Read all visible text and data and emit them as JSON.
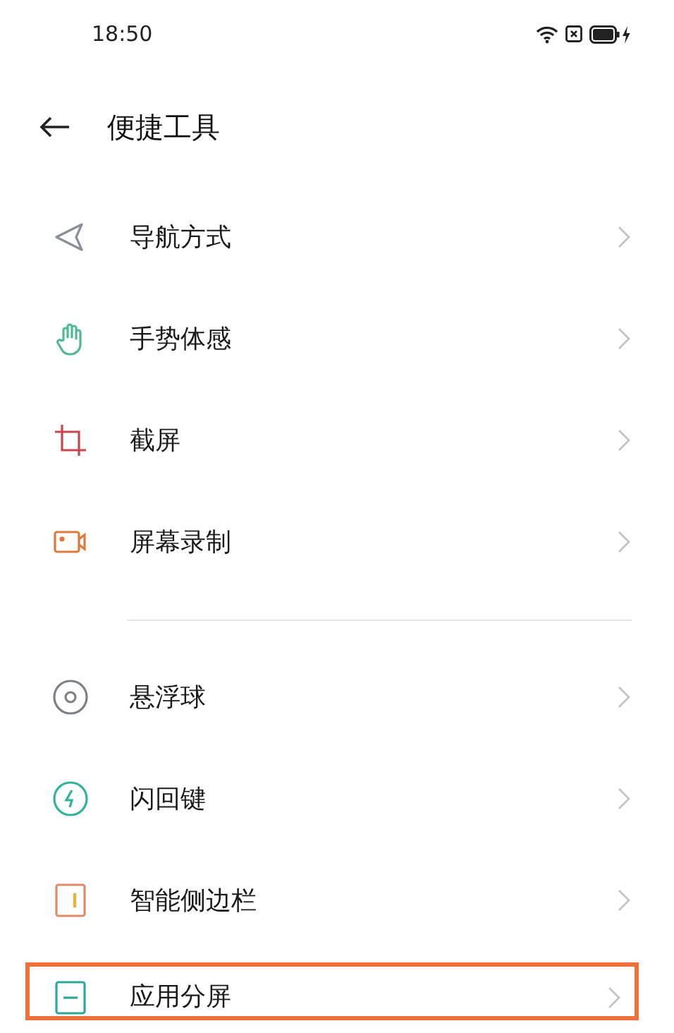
{
  "status_bar": {
    "time": "18:50"
  },
  "header": {
    "title": "便捷工具"
  },
  "sections": [
    {
      "items": [
        {
          "kind": "navigation",
          "label": "导航方式",
          "color": "#8a8f99",
          "highlighted": false
        },
        {
          "kind": "gesture",
          "label": "手势体感",
          "color": "#4fb98f",
          "highlighted": false
        },
        {
          "kind": "screenshot",
          "label": "截屏",
          "color": "#c9474f",
          "highlighted": false
        },
        {
          "kind": "record",
          "label": "屏幕录制",
          "color": "#e07a3c",
          "highlighted": false
        }
      ]
    },
    {
      "items": [
        {
          "kind": "floating_ball",
          "label": "悬浮球",
          "color": "#7d8088",
          "highlighted": false
        },
        {
          "kind": "flash",
          "label": "闪回键",
          "color": "#2fb39a",
          "highlighted": false
        },
        {
          "kind": "sidebar",
          "label": "智能侧边栏",
          "color": "#e08a6a",
          "highlighted": false
        },
        {
          "kind": "split",
          "label": "应用分屏",
          "color": "#2fa89a",
          "highlighted": true
        }
      ]
    }
  ]
}
